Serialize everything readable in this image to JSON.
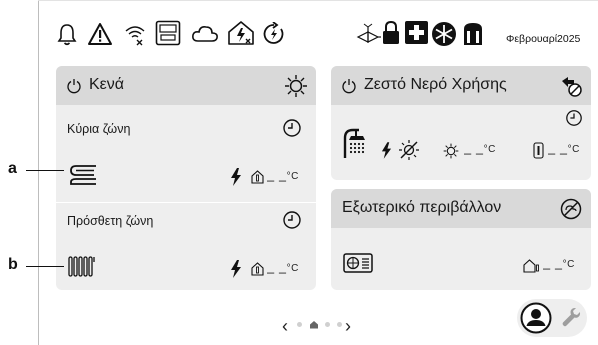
{
  "toolbar": {
    "icons": [
      "bell-icon",
      "warning-icon",
      "wifi-icon",
      "panel-icon",
      "cloud-icon",
      "house-smartgrid-icon",
      "boost-icon"
    ],
    "right_icons": [
      "valve-icon",
      "lock-icon",
      "plus-icon",
      "defrost-icon",
      "tank-icon"
    ],
    "date": "Φεβρουαρί2025"
  },
  "zones": {
    "title": "Κενά",
    "main": {
      "label": "Κύρια ζώνη",
      "value": "– –",
      "unit": "°C"
    },
    "additional": {
      "label": "Πρόσθετη ζώνη",
      "value": "– –",
      "unit": "°C"
    }
  },
  "dhw": {
    "title": "Ζεστό Νερό Χρήσης",
    "value1": "– –",
    "unit1": "°C",
    "value2": "– –",
    "unit2": "°C"
  },
  "outdoor": {
    "title": "Εξωτερικό περιβάλλον",
    "value": "– –",
    "unit": "°C"
  },
  "callouts": {
    "a": "a",
    "b": "b"
  },
  "nav": {
    "prev": "‹",
    "next": "›"
  }
}
